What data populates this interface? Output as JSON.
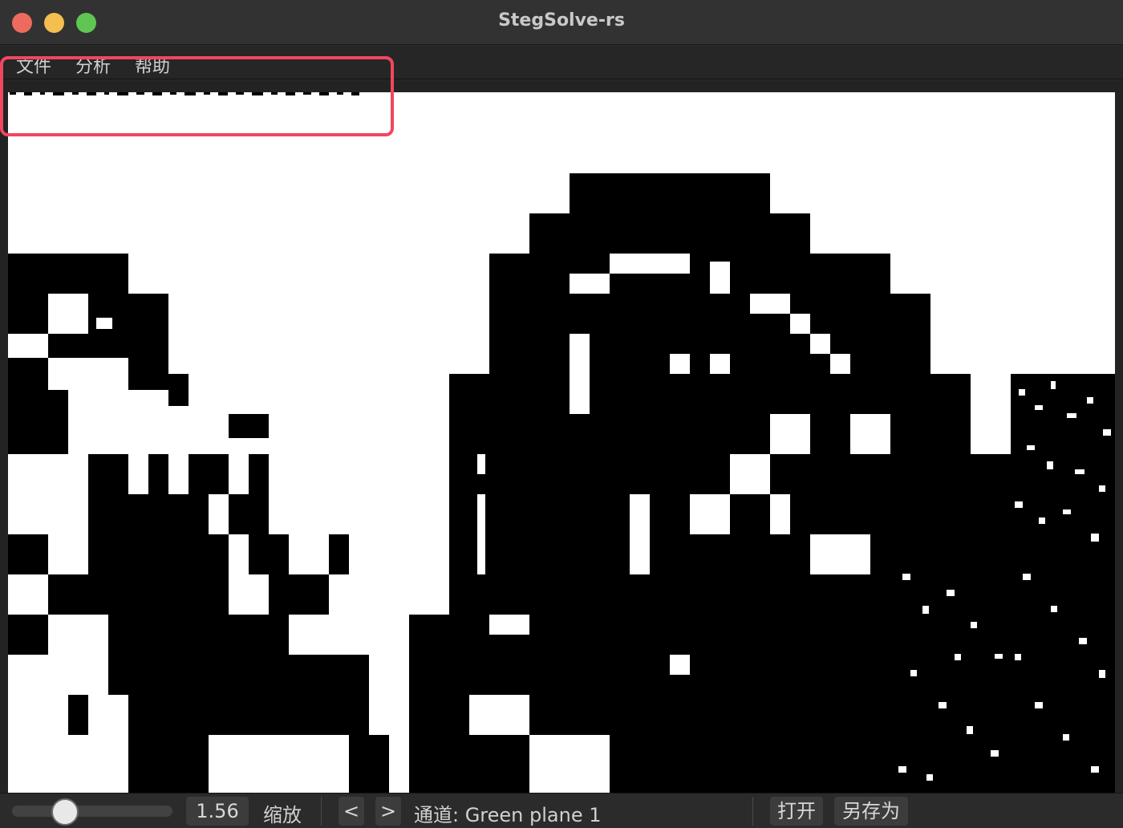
{
  "window": {
    "title": "StegSolve-rs"
  },
  "menubar": {
    "items": [
      {
        "label": "文件"
      },
      {
        "label": "分析"
      },
      {
        "label": "帮助"
      }
    ]
  },
  "statusbar": {
    "zoom_value": "1.56",
    "zoom_slider_fraction": 0.33,
    "zoom_label": "缩放",
    "prev_label": "<",
    "next_label": ">",
    "channel_text": "通道: Green plane 1",
    "open_label": "打开",
    "save_as_label": "另存为"
  },
  "image": {
    "description_icon": "bit-plane-image",
    "foreground": "#000000",
    "background": "#ffffff"
  },
  "colors": {
    "highlight": "#f0475f",
    "close": "#ed6a5e",
    "minimize": "#f5bf4f",
    "maximize": "#61c554"
  }
}
